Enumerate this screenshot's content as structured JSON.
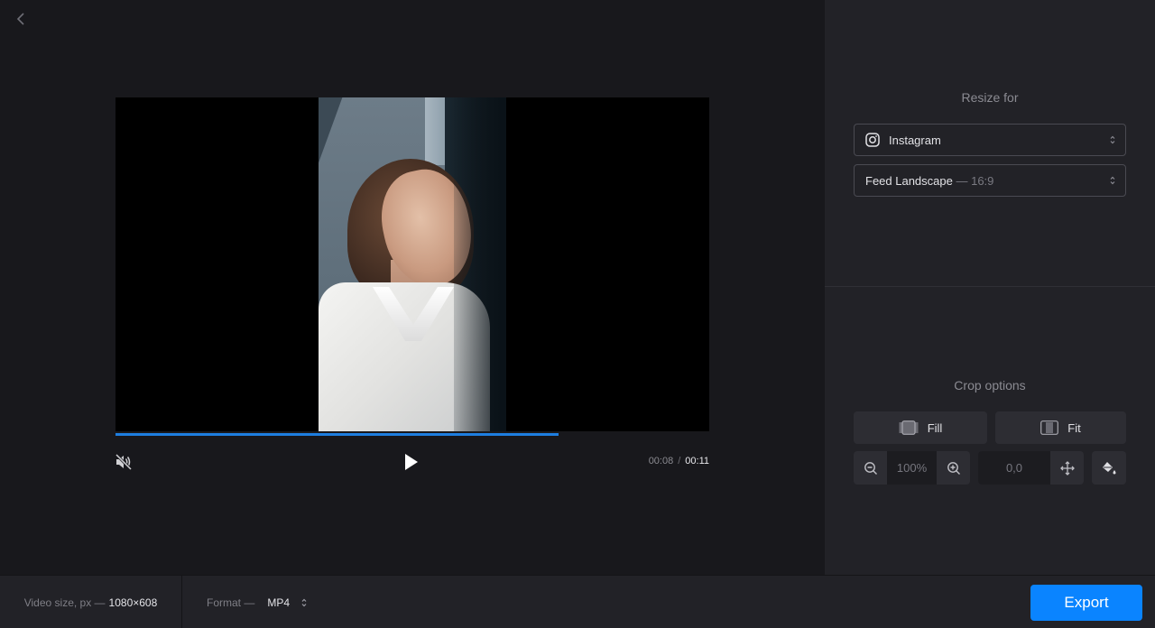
{
  "navigation": {
    "back_icon": "chevron-left-icon"
  },
  "player": {
    "current_time": "00:08",
    "separator": "/",
    "total_time": "00:11",
    "progress": 0.746,
    "muted": true,
    "mute_icon": "speaker-muted-icon",
    "play_icon": "play-icon"
  },
  "resize": {
    "title": "Resize for",
    "platform": {
      "icon": "instagram-icon",
      "value": "Instagram"
    },
    "preset": {
      "value": "Feed Landscape",
      "ratio": "— 16:9"
    }
  },
  "crop": {
    "title": "Crop options",
    "fill_label": "Fill",
    "fit_label": "Fit",
    "zoom_value": "100%",
    "position_value": "0,0"
  },
  "footer": {
    "size_label": "Video size, px —",
    "size_value": "1080×608",
    "format_label": "Format —",
    "format_value": "MP4",
    "export_label": "Export"
  },
  "colors": {
    "accent": "#0a84ff",
    "progress": "#1e7ee0",
    "panel": "#222227",
    "background": "#18181c"
  }
}
